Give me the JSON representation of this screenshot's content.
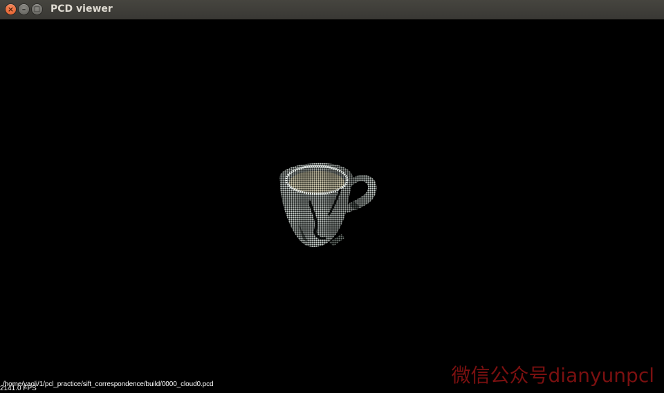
{
  "window": {
    "title": "PCD viewer",
    "buttons": {
      "close_glyph": "×",
      "minimize_glyph": "–",
      "maximize_glyph": "□"
    }
  },
  "viewer": {
    "background": "#000000",
    "point_color": "#cfd6d2",
    "file_path": "/home/yaoli/1/pcl_practice/sift_correspondence/build/0000_cloud0.pcd",
    "fps": "2141.0 FPS"
  },
  "watermark": {
    "text": "微信公众号dianyunpcl",
    "color": "#7a1010"
  }
}
